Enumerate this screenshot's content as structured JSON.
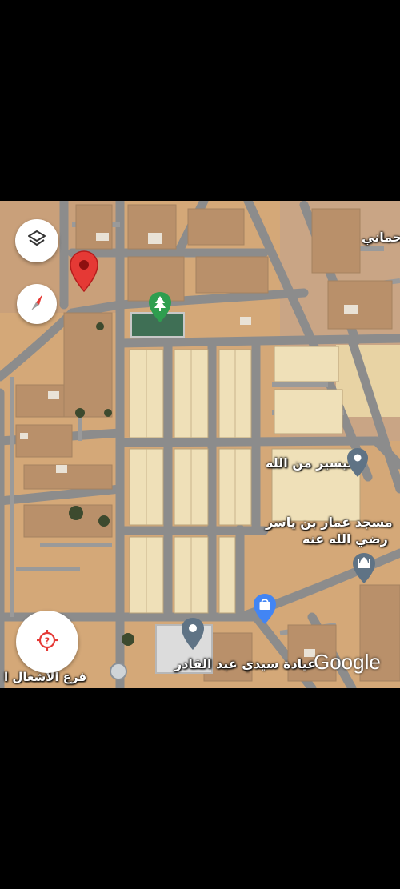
{
  "map": {
    "labels": {
      "top_right_partial": "رحماني",
      "place_1": "تيسير من الله",
      "mosque_line1": "مسجد عمار بن ياسر",
      "mosque_line2": "رضي الله عنه",
      "bottom_place": "عيادة سيدي عبد القادر",
      "bottom_left_partial": "فرع الأشغال ا"
    },
    "attribution": "Google"
  },
  "controls": {
    "layers": "layers-icon",
    "compass": "compass-icon",
    "locate": "my-location-icon"
  },
  "colors": {
    "pin_red": "#e53935",
    "park_green": "#2e9e4f",
    "place_gray": "#5f7385",
    "shop_blue": "#4285f4",
    "road": "#8a8a8a",
    "ground": "#d2a577"
  }
}
